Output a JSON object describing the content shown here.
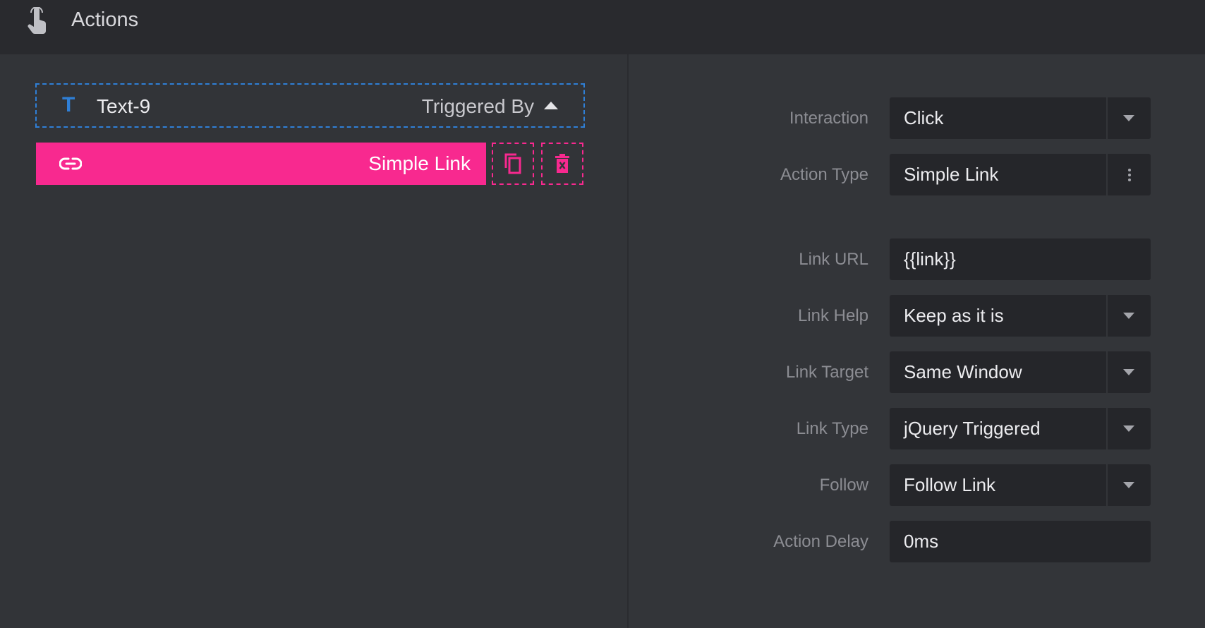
{
  "header": {
    "title": "Actions",
    "icon": "touch-hand-icon"
  },
  "trigger": {
    "element_icon": "T",
    "element_name": "Text-9",
    "triggered_by_label": "Triggered By"
  },
  "action": {
    "icon": "link-icon",
    "label": "Simple Link"
  },
  "accent_color": "#f8298f",
  "trigger_color": "#2f7fd6",
  "fields": {
    "interaction": {
      "label": "Interaction",
      "value": "Click"
    },
    "action_type": {
      "label": "Action Type",
      "value": "Simple Link"
    },
    "link_url": {
      "label": "Link URL",
      "value": "{{link}}"
    },
    "link_help": {
      "label": "Link Help",
      "value": "Keep as it is"
    },
    "link_target": {
      "label": "Link Target",
      "value": "Same Window"
    },
    "link_type": {
      "label": "Link Type",
      "value": "jQuery Triggered"
    },
    "follow": {
      "label": "Follow",
      "value": "Follow Link"
    },
    "action_delay": {
      "label": "Action Delay",
      "value": "0ms"
    }
  }
}
